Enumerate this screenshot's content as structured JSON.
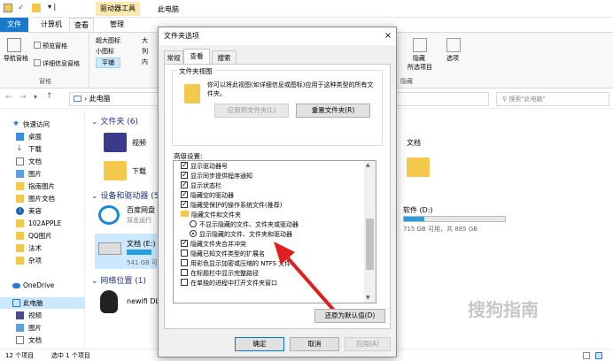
{
  "window": {
    "title": "此电脑",
    "tool_tab_header": "驱动器工具"
  },
  "tabs": [
    "文件",
    "计算机",
    "查看",
    "管理"
  ],
  "ribbon": {
    "nav_pane": "导航窗格",
    "preview_pane": "预览窗格",
    "details_pane": "详细信息窗格",
    "group_panes": "窗格",
    "layout_items": [
      "超大图标",
      "小图标",
      "平铺"
    ],
    "layout_col2": [
      "大",
      "列",
      "内"
    ],
    "hide_selected": "隐藏",
    "selected_items": "所选项目",
    "options": "选项",
    "group_hide": "隐藏"
  },
  "address": {
    "path": "此电脑",
    "search_placeholder": "搜索\"此电脑\""
  },
  "nav": [
    {
      "label": "快速访问",
      "icon": "star-icon"
    },
    {
      "label": "桌面",
      "icon": "desktop-icon"
    },
    {
      "label": "下载",
      "icon": "download-icon"
    },
    {
      "label": "文档",
      "icon": "document-icon"
    },
    {
      "label": "图片",
      "icon": "picture-icon"
    },
    {
      "label": "指南图片",
      "icon": "folder-icon"
    },
    {
      "label": "图片文档",
      "icon": "folder-icon"
    },
    {
      "label": "美容",
      "icon": "info-icon"
    },
    {
      "label": "102APPLE",
      "icon": "folder-icon"
    },
    {
      "label": "QQ图片",
      "icon": "folder-icon"
    },
    {
      "label": "法术",
      "icon": "folder-icon"
    },
    {
      "label": "杂项",
      "icon": "folder-icon"
    },
    {
      "label": "OneDrive",
      "icon": "cloud-icon"
    },
    {
      "label": "此电脑",
      "icon": "computer-icon"
    },
    {
      "label": "视频",
      "icon": "video-icon"
    },
    {
      "label": "图片",
      "icon": "picture-icon"
    },
    {
      "label": "文档",
      "icon": "document-icon"
    }
  ],
  "content": {
    "folders_header": "文件夹 (6)",
    "video": "视频",
    "download": "下载",
    "docs_right": "文档",
    "devices_header": "设备和驱动器 (5",
    "baidu": "百度网盘",
    "baidu_sub": "双击运行",
    "drive_e": "文档 (E:)",
    "drive_e_free": "541 GB 可",
    "drive_d": "软件 (D:)",
    "drive_d_free": "715 GB 可用，共 885 GB",
    "network_header": "网络位置 (1)",
    "network_item": "newifi DL"
  },
  "status": {
    "count": "12 个项目",
    "selected": "选中 1 个项目"
  },
  "dialog": {
    "title": "文件夹选项",
    "close": "×",
    "tabs": [
      "常规",
      "查看",
      "搜索"
    ],
    "folder_views_title": "文件夹视图",
    "folder_views_desc": "你可以将此视图(如详细信息或图标)应用于这种类型的所有文件夹。",
    "apply_to_folders": "应用到文件夹(L)",
    "reset_folders": "重置文件夹(R)",
    "advanced_label": "高级设置:",
    "options": [
      {
        "type": "check",
        "on": true,
        "label": "显示驱动器号"
      },
      {
        "type": "check",
        "on": true,
        "label": "显示同步提供程序通知"
      },
      {
        "type": "check",
        "on": true,
        "label": "显示状态栏"
      },
      {
        "type": "check",
        "on": true,
        "label": "隐藏空的驱动器"
      },
      {
        "type": "check",
        "on": true,
        "label": "隐藏受保护的操作系统文件(推荐)"
      },
      {
        "type": "folder",
        "label": "隐藏文件和文件夹"
      },
      {
        "type": "radio",
        "on": false,
        "label": "不显示隐藏的文件、文件夹或驱动器"
      },
      {
        "type": "radio",
        "on": true,
        "label": "显示隐藏的文件、文件夹和驱动器"
      },
      {
        "type": "check",
        "on": true,
        "label": "隐藏文件夹合并冲突"
      },
      {
        "type": "check",
        "on": false,
        "label": "隐藏已知文件类型的扩展名"
      },
      {
        "type": "check",
        "on": false,
        "label": "用彩色显示加密或压缩的 NTFS 文件"
      },
      {
        "type": "check",
        "on": false,
        "label": "在标题栏中显示完整路径"
      },
      {
        "type": "check",
        "on": false,
        "label": "在单独的进程中打开文件夹窗口"
      }
    ],
    "restore_defaults": "还原为默认值(D)",
    "ok": "确定",
    "cancel": "取消",
    "apply": "应用(A)"
  },
  "watermark": "搜狗指南"
}
